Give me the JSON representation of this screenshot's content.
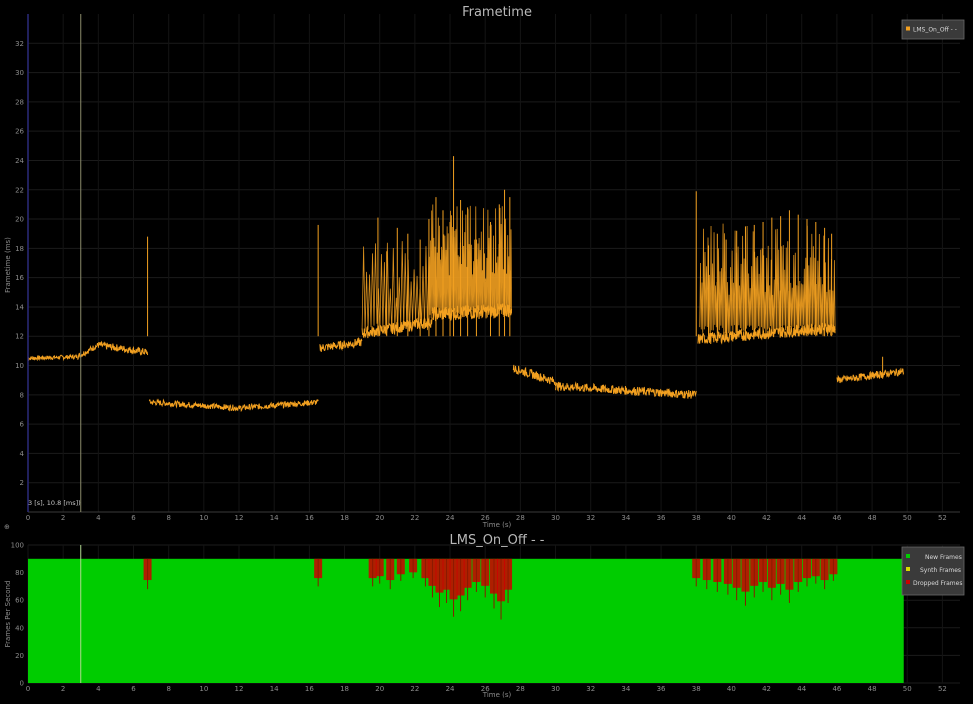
{
  "chart_data": [
    {
      "type": "line",
      "title": "Frametime",
      "xlabel": "Time (s)",
      "ylabel": "Frametime (ms)",
      "xlim": [
        0,
        53
      ],
      "ylim": [
        0,
        34
      ],
      "x_ticks": [
        "0",
        "2",
        "4",
        "6",
        "8",
        "10",
        "12",
        "14",
        "16",
        "18",
        "20",
        "22",
        "24",
        "26",
        "28",
        "30",
        "32",
        "34",
        "36",
        "38",
        "40",
        "42",
        "44",
        "46",
        "48",
        "50",
        "52"
      ],
      "y_ticks": [
        "2",
        "4",
        "6",
        "8",
        "10",
        "12",
        "14",
        "16",
        "18",
        "20",
        "22",
        "24",
        "26",
        "28",
        "30",
        "32"
      ],
      "grid": true,
      "legend_position": "top-right",
      "cursor_x": 3,
      "cursor_label": "3 [s], 10.8 [ms])",
      "series": [
        {
          "name": "LMS_On_Off - -",
          "color": "#f2a020",
          "segments": [
            {
              "x0": 0.0,
              "x1": 2.8,
              "base0": 10.5,
              "base1": 10.6,
              "noise": 0.15
            },
            {
              "x0": 2.8,
              "x1": 4.0,
              "base0": 10.6,
              "base1": 11.4,
              "noise": 0.2
            },
            {
              "x0": 4.0,
              "x1": 6.8,
              "base0": 11.4,
              "base1": 10.9,
              "noise": 0.25
            },
            {
              "x0": 6.9,
              "x1": 12.0,
              "base0": 7.5,
              "base1": 7.1,
              "noise": 0.2
            },
            {
              "x0": 12.0,
              "x1": 16.5,
              "base0": 7.1,
              "base1": 7.5,
              "noise": 0.2
            },
            {
              "x0": 16.6,
              "x1": 19.0,
              "base0": 11.2,
              "base1": 11.6,
              "noise": 0.3
            },
            {
              "x0": 19.0,
              "x1": 23.0,
              "base0": 12.2,
              "base1": 13.0,
              "noise": 0.4
            },
            {
              "x0": 23.0,
              "x1": 27.5,
              "base0": 13.5,
              "base1": 13.8,
              "noise": 0.5
            },
            {
              "x0": 27.6,
              "x1": 30.0,
              "base0": 9.8,
              "base1": 8.9,
              "noise": 0.3
            },
            {
              "x0": 30.0,
              "x1": 38.0,
              "base0": 8.6,
              "base1": 8.0,
              "noise": 0.3
            },
            {
              "x0": 38.1,
              "x1": 45.9,
              "base0": 11.8,
              "base1": 12.6,
              "noise": 0.4
            },
            {
              "x0": 46.0,
              "x1": 49.8,
              "base0": 9.0,
              "base1": 9.6,
              "noise": 0.25
            }
          ],
          "spikes": [
            {
              "x": 6.8,
              "y": 18.8
            },
            {
              "x": 16.5,
              "y": 19.6
            },
            {
              "x": 19.9,
              "y": 20.1
            },
            {
              "x": 20.4,
              "y": 17.8
            },
            {
              "x": 21.0,
              "y": 19.4
            },
            {
              "x": 21.6,
              "y": 19.0
            },
            {
              "x": 22.3,
              "y": 18.6
            },
            {
              "x": 22.8,
              "y": 20.0
            },
            {
              "x": 23.2,
              "y": 21.5
            },
            {
              "x": 23.6,
              "y": 20.6
            },
            {
              "x": 24.0,
              "y": 19.8
            },
            {
              "x": 24.2,
              "y": 24.3
            },
            {
              "x": 24.6,
              "y": 21.3
            },
            {
              "x": 25.0,
              "y": 20.8
            },
            {
              "x": 25.5,
              "y": 18.6
            },
            {
              "x": 26.3,
              "y": 19.8
            },
            {
              "x": 26.8,
              "y": 21.0
            },
            {
              "x": 27.1,
              "y": 22.0
            },
            {
              "x": 27.4,
              "y": 21.5
            },
            {
              "x": 38.0,
              "y": 21.9
            },
            {
              "x": 38.7,
              "y": 18.2
            },
            {
              "x": 39.2,
              "y": 19.0
            },
            {
              "x": 39.7,
              "y": 18.6
            },
            {
              "x": 40.3,
              "y": 19.2
            },
            {
              "x": 40.8,
              "y": 19.5
            },
            {
              "x": 41.3,
              "y": 19.6
            },
            {
              "x": 41.8,
              "y": 19.8
            },
            {
              "x": 42.3,
              "y": 20.1
            },
            {
              "x": 42.8,
              "y": 20.2
            },
            {
              "x": 43.3,
              "y": 20.6
            },
            {
              "x": 43.8,
              "y": 20.3
            },
            {
              "x": 44.3,
              "y": 20.0
            },
            {
              "x": 44.8,
              "y": 19.8
            },
            {
              "x": 45.3,
              "y": 19.4
            },
            {
              "x": 45.7,
              "y": 19.0
            },
            {
              "x": 48.6,
              "y": 10.6
            }
          ]
        }
      ]
    },
    {
      "type": "area",
      "title": "LMS_On_Off - -",
      "xlabel": "Time (s)",
      "ylabel": "Frames Per Second",
      "xlim": [
        0,
        53
      ],
      "ylim": [
        0,
        100
      ],
      "x_ticks": [
        "0",
        "2",
        "4",
        "6",
        "8",
        "10",
        "12",
        "14",
        "16",
        "18",
        "20",
        "22",
        "24",
        "26",
        "28",
        "30",
        "32",
        "34",
        "36",
        "38",
        "40",
        "42",
        "44",
        "46",
        "48",
        "50",
        "52"
      ],
      "y_ticks": [
        "0",
        "20",
        "40",
        "60",
        "80",
        "100"
      ],
      "grid": true,
      "legend_position": "top-right",
      "cursor_x": 3,
      "series": [
        {
          "name": "New Frames",
          "color": "#00cc00",
          "x_range": [
            0,
            49.8
          ],
          "value": 90
        },
        {
          "name": "Synth Frames",
          "color": "#d8d800"
        },
        {
          "name": "Dropped Frames",
          "color": "#cc0000",
          "drops": [
            {
              "x": 6.8,
              "depth": 22
            },
            {
              "x": 16.5,
              "depth": 20
            },
            {
              "x": 19.6,
              "depth": 20
            },
            {
              "x": 20.0,
              "depth": 18
            },
            {
              "x": 20.6,
              "depth": 22
            },
            {
              "x": 21.2,
              "depth": 16
            },
            {
              "x": 21.9,
              "depth": 14
            },
            {
              "x": 22.6,
              "depth": 20
            },
            {
              "x": 23.0,
              "depth": 28
            },
            {
              "x": 23.4,
              "depth": 35
            },
            {
              "x": 23.8,
              "depth": 32
            },
            {
              "x": 24.2,
              "depth": 42
            },
            {
              "x": 24.6,
              "depth": 38
            },
            {
              "x": 25.0,
              "depth": 30
            },
            {
              "x": 25.5,
              "depth": 24
            },
            {
              "x": 26.0,
              "depth": 28
            },
            {
              "x": 26.5,
              "depth": 36
            },
            {
              "x": 26.9,
              "depth": 44
            },
            {
              "x": 27.3,
              "depth": 32
            },
            {
              "x": 38.0,
              "depth": 20
            },
            {
              "x": 38.6,
              "depth": 22
            },
            {
              "x": 39.2,
              "depth": 24
            },
            {
              "x": 39.8,
              "depth": 26
            },
            {
              "x": 40.3,
              "depth": 30
            },
            {
              "x": 40.8,
              "depth": 34
            },
            {
              "x": 41.3,
              "depth": 28
            },
            {
              "x": 41.8,
              "depth": 24
            },
            {
              "x": 42.3,
              "depth": 30
            },
            {
              "x": 42.8,
              "depth": 26
            },
            {
              "x": 43.3,
              "depth": 32
            },
            {
              "x": 43.8,
              "depth": 24
            },
            {
              "x": 44.3,
              "depth": 20
            },
            {
              "x": 44.8,
              "depth": 18
            },
            {
              "x": 45.3,
              "depth": 22
            },
            {
              "x": 45.8,
              "depth": 16
            }
          ]
        }
      ]
    }
  ],
  "legend_top": {
    "label": "LMS_On_Off - -",
    "color": "#f2a020"
  },
  "legend_bottom": [
    {
      "label": "New Frames",
      "color": "#00cc00"
    },
    {
      "label": "Synth Frames",
      "color": "#d8d800"
    },
    {
      "label": "Dropped Frames",
      "color": "#cc0000"
    }
  ]
}
